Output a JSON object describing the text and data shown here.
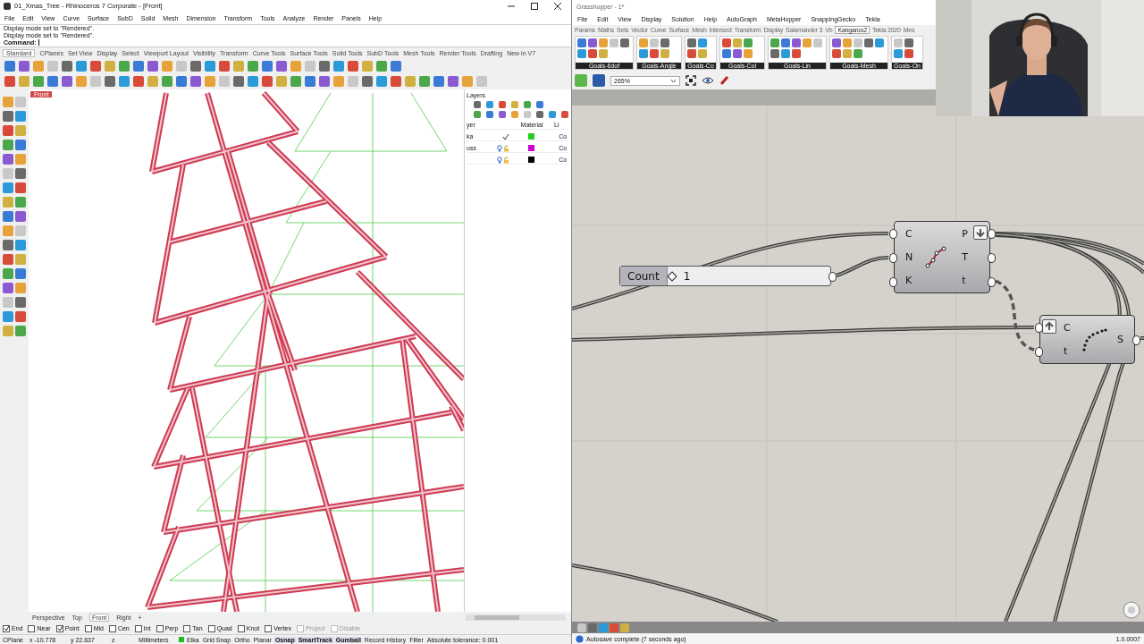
{
  "rhino": {
    "window_title": "01_Xmas_Tree - Rhinoceros 7 Corporate - [Front]",
    "menu": [
      "File",
      "Edit",
      "View",
      "Curve",
      "Surface",
      "SubD",
      "Solid",
      "Mesh",
      "Dimension",
      "Transform",
      "Tools",
      "Analyze",
      "Render",
      "Panels",
      "Help"
    ],
    "command_history": [
      "Display mode set to \"Rendered\".",
      "Display mode set to \"Rendered\"."
    ],
    "command_label": "Command:",
    "toolbar_tabs": [
      {
        "label": "Standard",
        "selected": true
      },
      {
        "label": "CPlanes",
        "selected": false
      },
      {
        "label": "Set View",
        "selected": false
      },
      {
        "label": "Display",
        "selected": false
      },
      {
        "label": "Select",
        "selected": false
      },
      {
        "label": "Viewport Layout",
        "selected": false
      },
      {
        "label": "Visibility",
        "selected": false
      },
      {
        "label": "Transform",
        "selected": false
      },
      {
        "label": "Curve Tools",
        "selected": false
      },
      {
        "label": "Surface Tools",
        "selected": false
      },
      {
        "label": "Solid Tools",
        "selected": false
      },
      {
        "label": "SubD Tools",
        "selected": false
      },
      {
        "label": "Mesh Tools",
        "selected": false
      },
      {
        "label": "Render Tools",
        "selected": false
      },
      {
        "label": "Drafting",
        "selected": false
      },
      {
        "label": "New in V7",
        "selected": false
      }
    ],
    "viewport_label": "Front",
    "layers": {
      "title": "Layers",
      "columns": [
        "yer",
        "Material",
        "Li"
      ],
      "rows": [
        {
          "name": "ka",
          "current": true,
          "color": "#22cc22",
          "linetype": "Co"
        },
        {
          "name": "uss",
          "current": false,
          "color": "#cc00cc",
          "linetype": "Co"
        },
        {
          "current": false,
          "color": "#000000",
          "linetype": "Co"
        }
      ]
    },
    "viewport_tabs": [
      {
        "label": "Perspective",
        "selected": false
      },
      {
        "label": "Top",
        "selected": false
      },
      {
        "label": "Front",
        "selected": true
      },
      {
        "label": "Right",
        "selected": false
      }
    ],
    "add_tab": "+",
    "osnaps": [
      {
        "label": "End",
        "checked": true,
        "disabled": false
      },
      {
        "label": "Near",
        "checked": false,
        "disabled": false
      },
      {
        "label": "Point",
        "checked": true,
        "disabled": false
      },
      {
        "label": "Mid",
        "checked": false,
        "disabled": false
      },
      {
        "label": "Cen",
        "checked": false,
        "disabled": false
      },
      {
        "label": "Int",
        "checked": false,
        "disabled": false
      },
      {
        "label": "Perp",
        "checked": false,
        "disabled": false
      },
      {
        "label": "Tan",
        "checked": false,
        "disabled": false
      },
      {
        "label": "Quad",
        "checked": false,
        "disabled": false
      },
      {
        "label": "Knot",
        "checked": false,
        "disabled": false
      },
      {
        "label": "Vertex",
        "checked": false,
        "disabled": false
      },
      {
        "label": "Project",
        "checked": false,
        "disabled": true
      },
      {
        "label": "Disable",
        "checked": false,
        "disabled": true
      }
    ],
    "status_bar": {
      "cplane": "CPlane",
      "x": "x -10.778",
      "y": "y 22.637",
      "z": "z",
      "units": "Millimeters",
      "layer": {
        "name": "Elka",
        "color": "#22bb22"
      },
      "toggles": [
        {
          "label": "Grid Snap",
          "on": false
        },
        {
          "label": "Ortho",
          "on": false
        },
        {
          "label": "Planar",
          "on": false
        },
        {
          "label": "Osnap",
          "on": true
        },
        {
          "label": "SmartTrack",
          "on": true
        },
        {
          "label": "Gumball",
          "on": true
        },
        {
          "label": "Record History",
          "on": false
        },
        {
          "label": "Filter",
          "on": false
        }
      ],
      "tolerance": "Absolute tolerance: 0.001"
    }
  },
  "grasshopper": {
    "window_title": "Grasshopper - 1*",
    "menu": [
      "File",
      "Edit",
      "View",
      "Display",
      "Solution",
      "Help",
      "AutoGraph",
      "MetaHopper",
      "SnappingGecko",
      "Tekla"
    ],
    "tabs": [
      {
        "label": "Params",
        "selected": false
      },
      {
        "label": "Maths",
        "selected": false
      },
      {
        "label": "Sets",
        "selected": false
      },
      {
        "label": "Vector",
        "selected": false
      },
      {
        "label": "Curve",
        "selected": false
      },
      {
        "label": "Surface",
        "selected": false
      },
      {
        "label": "Mesh",
        "selected": false
      },
      {
        "label": "Intersect",
        "selected": false
      },
      {
        "label": "Transform",
        "selected": false
      },
      {
        "label": "Display",
        "selected": false
      },
      {
        "label": "Salamander 3",
        "selected": false
      },
      {
        "label": "Vb",
        "selected": false
      },
      {
        "label": "Kangaroo2",
        "selected": true
      },
      {
        "label": "Tekla 2020",
        "selected": false
      },
      {
        "label": "Mes",
        "selected": false
      }
    ],
    "ribbon_groups": [
      "Goals-6dof",
      "Goals-Angle",
      "Goals-Co",
      "Goals-Col",
      "Goals-Lin",
      "Goals-Mesh",
      "Goals-On"
    ],
    "zoom": "265%",
    "slider": {
      "label": "Count",
      "value": "1",
      "level": 0
    },
    "components": [
      {
        "kind": "divide",
        "inputs": [
          "C",
          "N",
          "K"
        ],
        "outputs": [
          "P",
          "T",
          "t"
        ],
        "button": {
          "kind": "down"
        }
      },
      {
        "kind": "points",
        "inputs": [
          "C",
          "t"
        ],
        "outputs": [
          "S"
        ],
        "button": {
          "kind": "up"
        }
      }
    ],
    "status": "Autosave complete (7 seconds ago)",
    "version": "1.0.0007"
  }
}
